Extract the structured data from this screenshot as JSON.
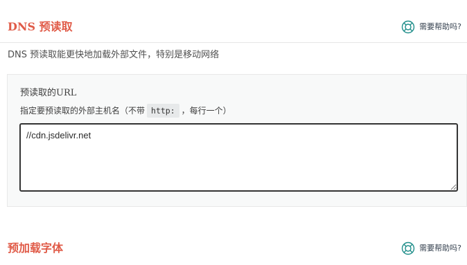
{
  "dns_section": {
    "title": "DNS 预读取",
    "help_label": "需要帮助吗?",
    "help_icon": "lifebuoy-icon",
    "description": "DNS 预读取能更快地加载外部文件，特别是移动网络"
  },
  "prefetch_field": {
    "label": "预读取的URL",
    "hint_before": "指定要预读取的外部主机名（不带",
    "hint_code": "http:",
    "hint_after": "，每行一个）",
    "value": "//cdn.jsdelivr.net"
  },
  "font_section": {
    "title": "预加载字体",
    "help_label": "需要帮助吗?",
    "help_icon": "lifebuoy-icon"
  },
  "colors": {
    "title_accent": "#e05b48",
    "help_icon": "#1f8e8a",
    "panel_bg": "#f8f9f9"
  }
}
